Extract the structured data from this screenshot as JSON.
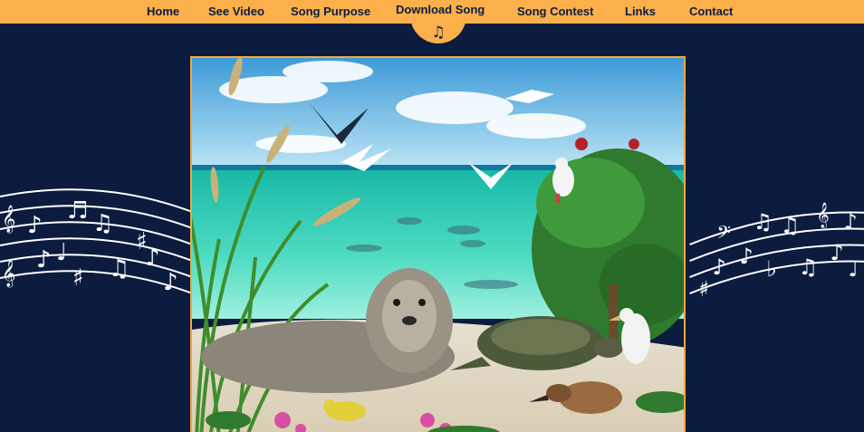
{
  "nav": {
    "items": [
      {
        "label": "Home"
      },
      {
        "label": "See Video"
      },
      {
        "label": "Song Purpose"
      },
      {
        "label": "Download Song"
      },
      {
        "label": "Song Contest"
      },
      {
        "label": "Links"
      },
      {
        "label": "Contact"
      }
    ],
    "active_icon": "music-note-icon"
  },
  "hero": {
    "alt": "Painting of a Hawaiian monk seal, green sea turtle, seabirds and reef fish on a tropical beach"
  },
  "colors": {
    "nav_bg": "#fbb04b",
    "page_bg": "#0b1c3f",
    "text": "#0b1c3f",
    "frame": "#f2a93b"
  }
}
